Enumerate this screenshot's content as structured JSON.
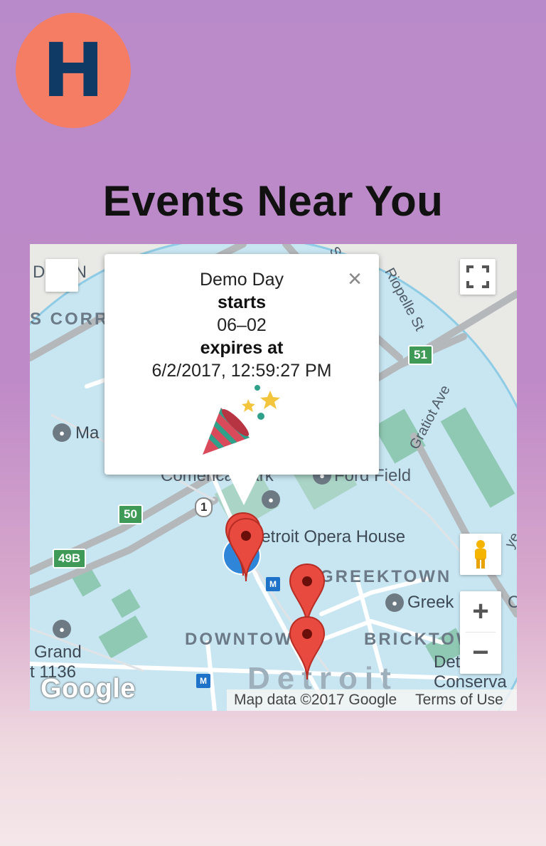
{
  "app": {
    "logo_letter": "H",
    "title": "Events Near You"
  },
  "map": {
    "place_labels": {
      "downtown_top": "DOWN",
      "s_corr": "S CORR",
      "riopelle": "Riopelle St",
      "ma": "Ma",
      "comerica_park": "Comerica Park",
      "ford_field": "Ford Field",
      "gratiot_ave": "Gratiot Ave",
      "detroit_opera_house": "Detroit Opera House",
      "greektown_area": "GREEKTOWN",
      "greektown_poi": "Greek",
      "downtown": "DOWNTOWN",
      "bricktown": "BRICKTOWN",
      "grand": "Grand",
      "t1136": "t 1136",
      "detroit_city": "Detroit",
      "det_ri": "Det  Ri",
      "conserva": "Conserva",
      "ye": "ye",
      "c": "C",
      "s_top": "S",
      "e_top": "e"
    },
    "route_shields": [
      "51",
      "50",
      "49B",
      "1"
    ],
    "attribution": {
      "map_data": "Map data ©2017 Google",
      "terms": "Terms of Use"
    },
    "google_logo": "Google",
    "controls": {
      "zoom_in": "+",
      "zoom_out": "−"
    },
    "info_window": {
      "event_name": "Demo Day",
      "starts_label": "starts",
      "starts_value": "06–02",
      "expires_label": "expires at",
      "expires_value": "6/2/2017, 12:59:27 PM",
      "close": "×"
    },
    "colors": {
      "water_area": "#c8e6f2",
      "park_green": "#8fc9b3",
      "marker_red": "#e94a3f",
      "location_blue": "#2f86d9"
    }
  }
}
